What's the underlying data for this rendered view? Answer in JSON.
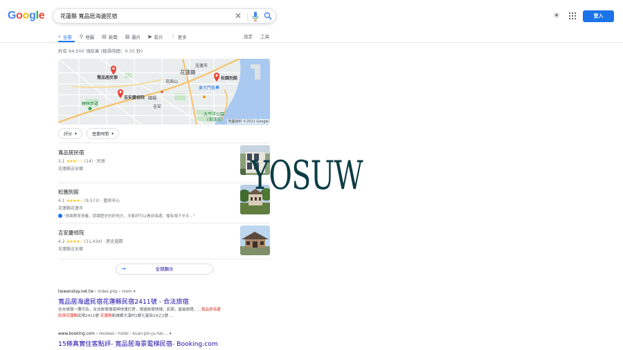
{
  "header": {
    "logo_letters": [
      {
        "ch": "G",
        "color": "#4285f4"
      },
      {
        "ch": "o",
        "color": "#ea4335"
      },
      {
        "ch": "o",
        "color": "#fbbc05"
      },
      {
        "ch": "g",
        "color": "#4285f4"
      },
      {
        "ch": "l",
        "color": "#34a853"
      },
      {
        "ch": "e",
        "color": "#ea4335"
      }
    ],
    "query": "花蓮縣 寬品居海邊民宿",
    "signin_label": "登入",
    "icons": [
      "clear-icon",
      "mic-icon",
      "search-icon",
      "theme-icon",
      "apps-icon"
    ]
  },
  "tabs": [
    {
      "icon": "⌕",
      "label": "全部",
      "active": true
    },
    {
      "icon": "⚲",
      "label": "地圖"
    },
    {
      "icon": "▤",
      "label": "新聞"
    },
    {
      "icon": "▨",
      "label": "圖片"
    },
    {
      "icon": "▶",
      "label": "影片"
    },
    {
      "icon": "⋮",
      "label": "更多"
    }
  ],
  "tools": {
    "settings": "設定",
    "tools": "工具"
  },
  "stats": "約有 64,500 項結果 (搜尋時間：0.35 秒)",
  "map": {
    "labels": {
      "city": "花蓮縣",
      "station": "花蓮市",
      "market": "東大門夜市",
      "pin1": "寬品居民宿",
      "pin2": "松園別館",
      "pin3": "吉安慶修院",
      "park1": "太平洋公園",
      "park2": "(南濱段)",
      "trail": "鯉林步道",
      "road": "吉安",
      "area": "國福",
      "area2": "花崗山"
    },
    "credit": "地圖資料 ©2021 Google"
  },
  "filters": [
    "評分",
    "營業時間"
  ],
  "places": [
    {
      "name": "寬品居民宿",
      "rating": "3.1",
      "stars": "★★★☆☆",
      "count": "(14)",
      "type": "民宿",
      "address": "花蓮縣吉安鄉",
      "review": ""
    },
    {
      "name": "松園別館",
      "rating": "4.1",
      "stars": "★★★★☆",
      "count": "(9,573)",
      "type": "藝術中心",
      "address": "花蓮縣花蓮市",
      "review": "\"很具教育意義，認識歷史的好地方，天氣好可以看到海邊，擋有場下半天...\""
    },
    {
      "name": "吉安慶修院",
      "rating": "4.2",
      "stars": "★★★★☆",
      "count": "(11,434)",
      "type": "歷史遺蹟",
      "address": "花蓮縣吉安鄉",
      "review": ""
    }
  ],
  "all_results_label": "全部顯示",
  "results": [
    {
      "domain": "taiwanstay.net.tw",
      "path": " › index.php › room",
      "title": "寬品居海邊民宿花蓮縣民宿2411號 - 合法旅宿",
      "snip1a": "全台旅宿一攬可及，合法旅宿搜尋與快速訂房，環遊旅宿快搜，民宿，星級旅館，...",
      "snip1b": "寬品居海邊",
      "snip2a": "民宿花蓮縣",
      "snip2b": "民宿2411號 ",
      "snip2c": "花蓮縣",
      "snip2d": "新城鄉大漢村1鄰七星街19之2號 ..."
    },
    {
      "domain": "www.booking.com",
      "path": " › reviews › hotel › kuan-pin-ju-hai-...",
      "title": "15條真實住客點評- 寬品居海景電梯民宿- Booking.com"
    }
  ],
  "watermark": "YOSUW"
}
